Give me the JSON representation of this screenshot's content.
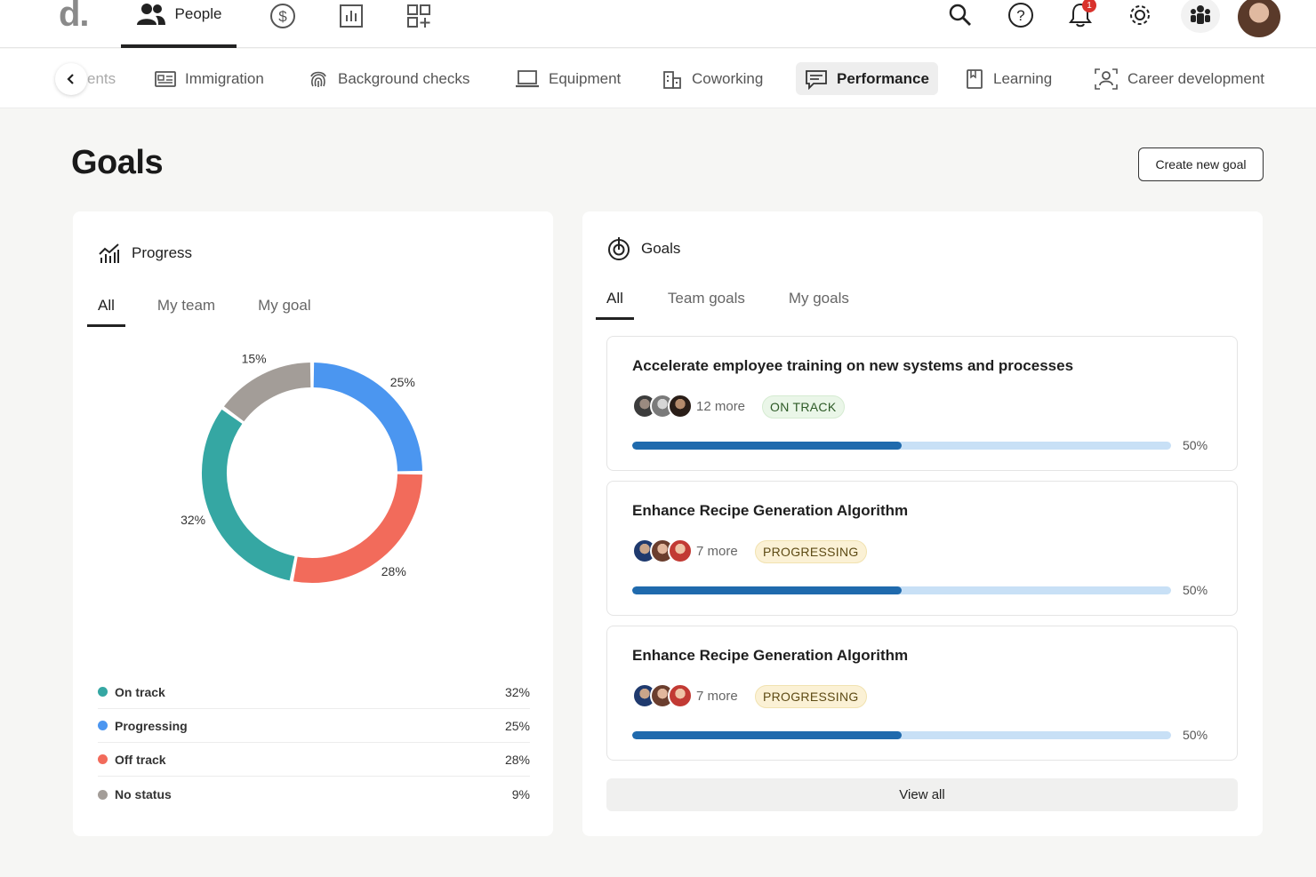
{
  "topbar": {
    "logo": "d.",
    "people_label": "People",
    "notification_count": "1"
  },
  "subnav": {
    "tabs": [
      {
        "label": "ents",
        "icon": "none"
      },
      {
        "label": "Immigration",
        "icon": "id-card-icon"
      },
      {
        "label": "Background checks",
        "icon": "fingerprint-icon"
      },
      {
        "label": "Equipment",
        "icon": "laptop-icon"
      },
      {
        "label": "Coworking",
        "icon": "building-icon"
      },
      {
        "label": "Performance",
        "icon": "chat-icon",
        "active": true
      },
      {
        "label": "Learning",
        "icon": "book-icon"
      },
      {
        "label": "Career development",
        "icon": "career-icon"
      }
    ]
  },
  "page": {
    "title": "Goals",
    "create_button": "Create new goal"
  },
  "progress": {
    "title": "Progress",
    "tabs": [
      "All",
      "My team",
      "My goal"
    ],
    "active_tab": "All",
    "legend": [
      {
        "label": "On track",
        "value": "32%",
        "color": "#35a7a3"
      },
      {
        "label": "Progressing",
        "value": "25%",
        "color": "#4b96f0"
      },
      {
        "label": "Off track",
        "value": "28%",
        "color": "#f26b5b"
      },
      {
        "label": "No status",
        "value": "9%",
        "color": "#a39d98"
      }
    ]
  },
  "chart_data": {
    "type": "pie",
    "categories": [
      "Progressing",
      "Off track",
      "On track",
      "No status"
    ],
    "values": [
      25,
      28,
      32,
      15
    ],
    "labels": [
      "25%",
      "28%",
      "32%",
      "15%"
    ],
    "colors": [
      "#4b96f0",
      "#f26b5b",
      "#35a7a3",
      "#a39d98"
    ]
  },
  "goals": {
    "title": "Goals",
    "tabs": [
      "All",
      "Team goals",
      "My goals"
    ],
    "active_tab": "All",
    "items": [
      {
        "title": "Accelerate employee training on new systems and processes",
        "more": "12 more",
        "status": "ON TRACK",
        "status_kind": "on-track",
        "progress": 0.5,
        "progress_label": "50%"
      },
      {
        "title": "Enhance Recipe Generation Algorithm",
        "more": "7 more",
        "status": "PROGRESSING",
        "status_kind": "progressing",
        "progress": 0.5,
        "progress_label": "50%"
      },
      {
        "title": "Enhance Recipe Generation Algorithm",
        "more": "7 more",
        "status": "PROGRESSING",
        "status_kind": "progressing",
        "progress": 0.5,
        "progress_label": "50%"
      }
    ],
    "view_all": "View all"
  }
}
